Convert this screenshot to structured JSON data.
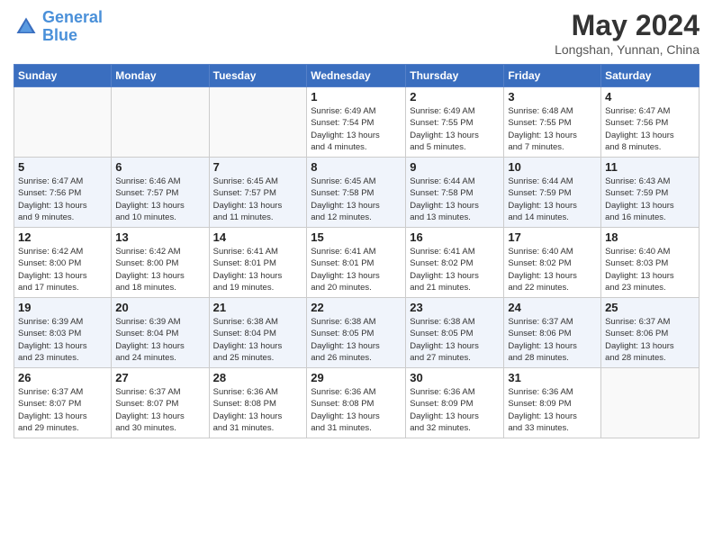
{
  "header": {
    "logo_line1": "General",
    "logo_line2": "Blue",
    "main_title": "May 2024",
    "subtitle": "Longshan, Yunnan, China"
  },
  "days_of_week": [
    "Sunday",
    "Monday",
    "Tuesday",
    "Wednesday",
    "Thursday",
    "Friday",
    "Saturday"
  ],
  "weeks": [
    [
      {
        "day": "",
        "info": ""
      },
      {
        "day": "",
        "info": ""
      },
      {
        "day": "",
        "info": ""
      },
      {
        "day": "1",
        "info": "Sunrise: 6:49 AM\nSunset: 7:54 PM\nDaylight: 13 hours\nand 4 minutes."
      },
      {
        "day": "2",
        "info": "Sunrise: 6:49 AM\nSunset: 7:55 PM\nDaylight: 13 hours\nand 5 minutes."
      },
      {
        "day": "3",
        "info": "Sunrise: 6:48 AM\nSunset: 7:55 PM\nDaylight: 13 hours\nand 7 minutes."
      },
      {
        "day": "4",
        "info": "Sunrise: 6:47 AM\nSunset: 7:56 PM\nDaylight: 13 hours\nand 8 minutes."
      }
    ],
    [
      {
        "day": "5",
        "info": "Sunrise: 6:47 AM\nSunset: 7:56 PM\nDaylight: 13 hours\nand 9 minutes."
      },
      {
        "day": "6",
        "info": "Sunrise: 6:46 AM\nSunset: 7:57 PM\nDaylight: 13 hours\nand 10 minutes."
      },
      {
        "day": "7",
        "info": "Sunrise: 6:45 AM\nSunset: 7:57 PM\nDaylight: 13 hours\nand 11 minutes."
      },
      {
        "day": "8",
        "info": "Sunrise: 6:45 AM\nSunset: 7:58 PM\nDaylight: 13 hours\nand 12 minutes."
      },
      {
        "day": "9",
        "info": "Sunrise: 6:44 AM\nSunset: 7:58 PM\nDaylight: 13 hours\nand 13 minutes."
      },
      {
        "day": "10",
        "info": "Sunrise: 6:44 AM\nSunset: 7:59 PM\nDaylight: 13 hours\nand 14 minutes."
      },
      {
        "day": "11",
        "info": "Sunrise: 6:43 AM\nSunset: 7:59 PM\nDaylight: 13 hours\nand 16 minutes."
      }
    ],
    [
      {
        "day": "12",
        "info": "Sunrise: 6:42 AM\nSunset: 8:00 PM\nDaylight: 13 hours\nand 17 minutes."
      },
      {
        "day": "13",
        "info": "Sunrise: 6:42 AM\nSunset: 8:00 PM\nDaylight: 13 hours\nand 18 minutes."
      },
      {
        "day": "14",
        "info": "Sunrise: 6:41 AM\nSunset: 8:01 PM\nDaylight: 13 hours\nand 19 minutes."
      },
      {
        "day": "15",
        "info": "Sunrise: 6:41 AM\nSunset: 8:01 PM\nDaylight: 13 hours\nand 20 minutes."
      },
      {
        "day": "16",
        "info": "Sunrise: 6:41 AM\nSunset: 8:02 PM\nDaylight: 13 hours\nand 21 minutes."
      },
      {
        "day": "17",
        "info": "Sunrise: 6:40 AM\nSunset: 8:02 PM\nDaylight: 13 hours\nand 22 minutes."
      },
      {
        "day": "18",
        "info": "Sunrise: 6:40 AM\nSunset: 8:03 PM\nDaylight: 13 hours\nand 23 minutes."
      }
    ],
    [
      {
        "day": "19",
        "info": "Sunrise: 6:39 AM\nSunset: 8:03 PM\nDaylight: 13 hours\nand 23 minutes."
      },
      {
        "day": "20",
        "info": "Sunrise: 6:39 AM\nSunset: 8:04 PM\nDaylight: 13 hours\nand 24 minutes."
      },
      {
        "day": "21",
        "info": "Sunrise: 6:38 AM\nSunset: 8:04 PM\nDaylight: 13 hours\nand 25 minutes."
      },
      {
        "day": "22",
        "info": "Sunrise: 6:38 AM\nSunset: 8:05 PM\nDaylight: 13 hours\nand 26 minutes."
      },
      {
        "day": "23",
        "info": "Sunrise: 6:38 AM\nSunset: 8:05 PM\nDaylight: 13 hours\nand 27 minutes."
      },
      {
        "day": "24",
        "info": "Sunrise: 6:37 AM\nSunset: 8:06 PM\nDaylight: 13 hours\nand 28 minutes."
      },
      {
        "day": "25",
        "info": "Sunrise: 6:37 AM\nSunset: 8:06 PM\nDaylight: 13 hours\nand 28 minutes."
      }
    ],
    [
      {
        "day": "26",
        "info": "Sunrise: 6:37 AM\nSunset: 8:07 PM\nDaylight: 13 hours\nand 29 minutes."
      },
      {
        "day": "27",
        "info": "Sunrise: 6:37 AM\nSunset: 8:07 PM\nDaylight: 13 hours\nand 30 minutes."
      },
      {
        "day": "28",
        "info": "Sunrise: 6:36 AM\nSunset: 8:08 PM\nDaylight: 13 hours\nand 31 minutes."
      },
      {
        "day": "29",
        "info": "Sunrise: 6:36 AM\nSunset: 8:08 PM\nDaylight: 13 hours\nand 31 minutes."
      },
      {
        "day": "30",
        "info": "Sunrise: 6:36 AM\nSunset: 8:09 PM\nDaylight: 13 hours\nand 32 minutes."
      },
      {
        "day": "31",
        "info": "Sunrise: 6:36 AM\nSunset: 8:09 PM\nDaylight: 13 hours\nand 33 minutes."
      },
      {
        "day": "",
        "info": ""
      }
    ]
  ]
}
